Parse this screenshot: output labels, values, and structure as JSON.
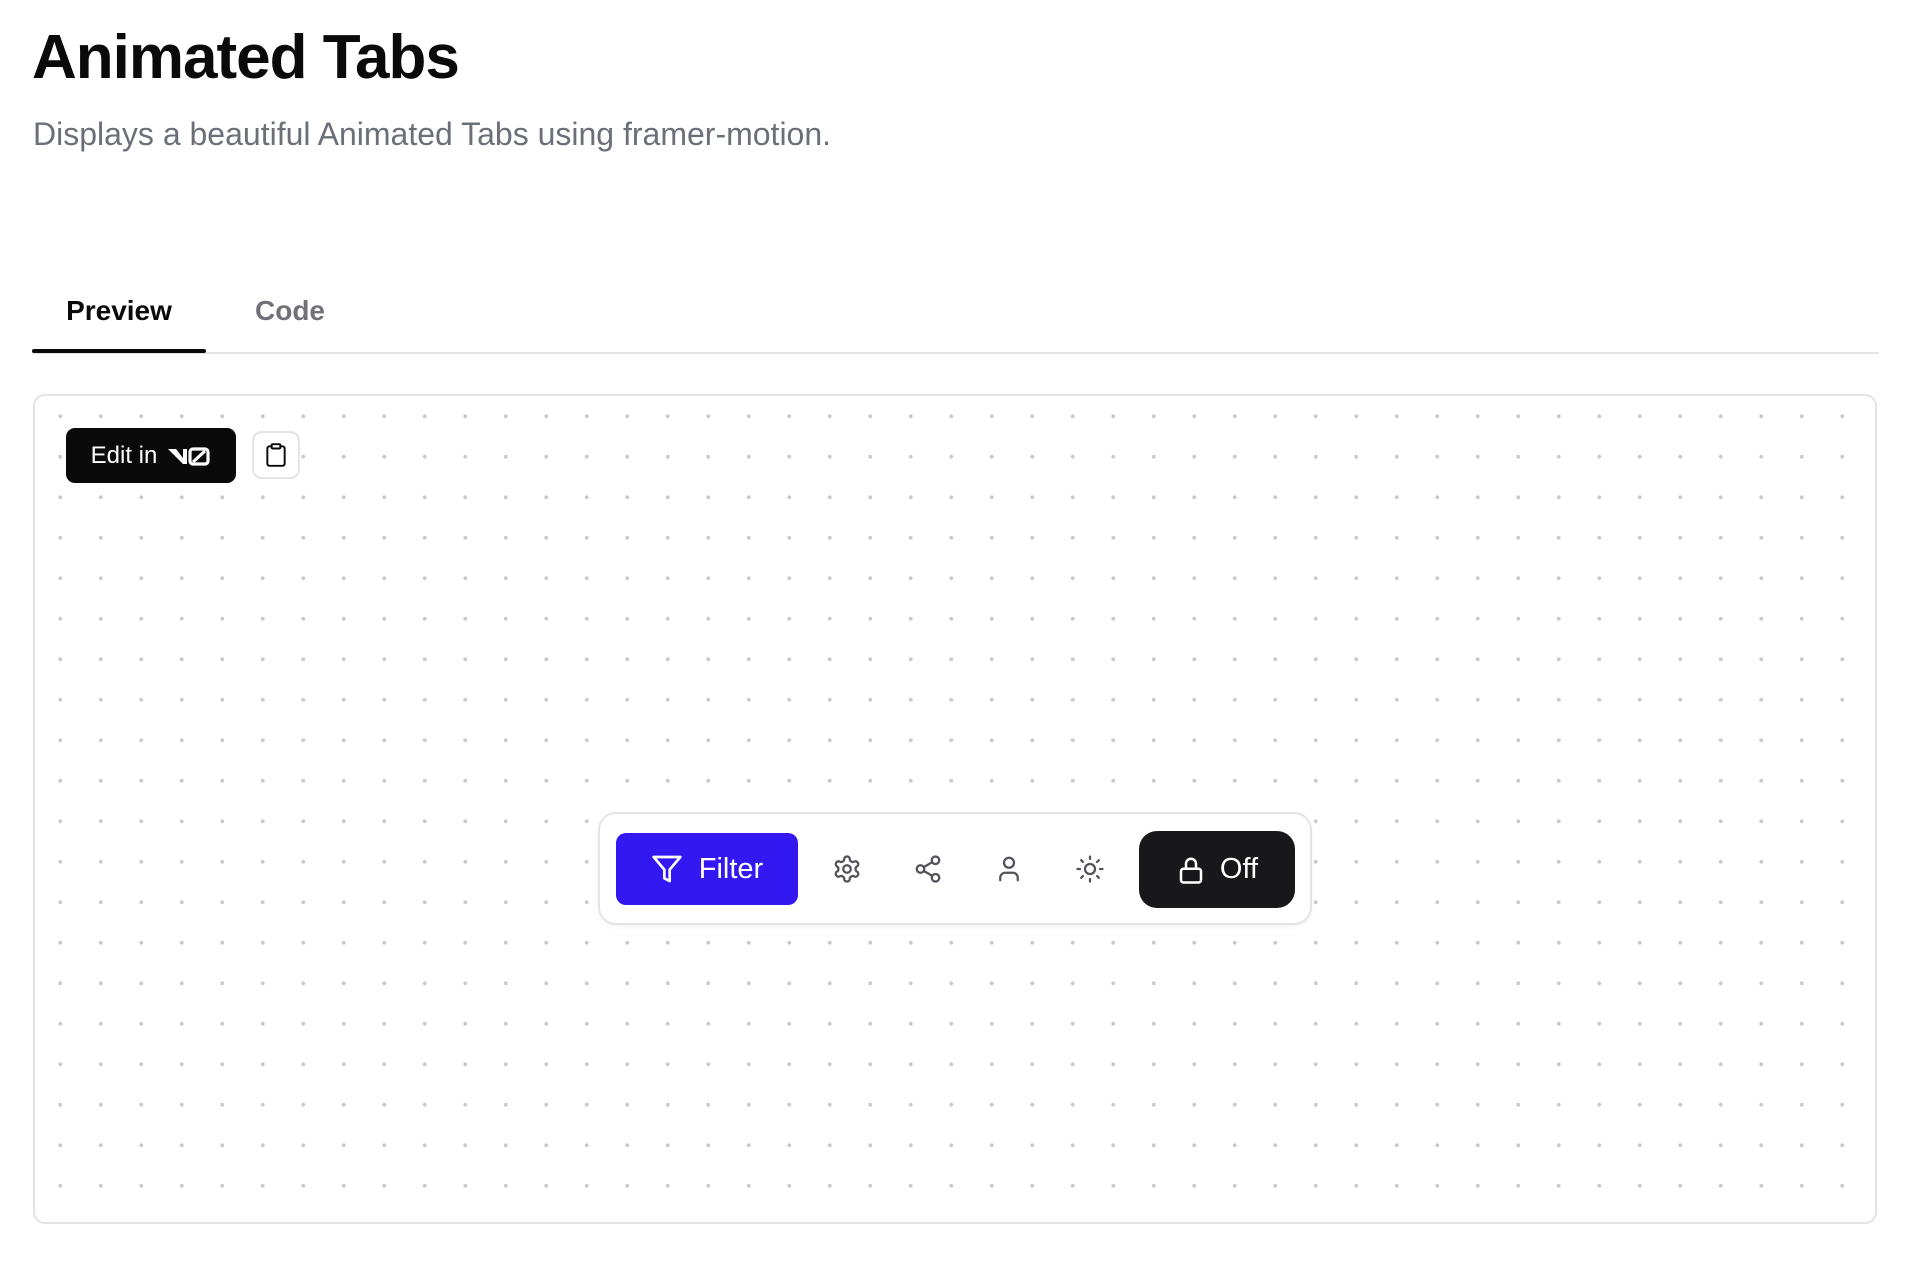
{
  "header": {
    "title": "Animated Tabs",
    "subtitle": "Displays a beautiful Animated Tabs using framer-motion."
  },
  "tabs": [
    {
      "label": "Preview",
      "active": true
    },
    {
      "label": "Code",
      "active": false
    }
  ],
  "preview": {
    "edit_button": {
      "label": "Edit in",
      "logo": "v0-logo"
    },
    "copy_button": {
      "icon": "clipboard-icon"
    },
    "toolbar": {
      "filter_button": {
        "label": "Filter",
        "icon": "filter-icon"
      },
      "icon_buttons": [
        {
          "icon": "gear-icon"
        },
        {
          "icon": "share-icon"
        },
        {
          "icon": "user-icon"
        },
        {
          "icon": "sun-icon"
        }
      ],
      "lock_button": {
        "label": "Off",
        "icon": "lock-icon"
      }
    }
  },
  "colors": {
    "accent": "#3418f2",
    "dark": "#18181b",
    "muted_text": "#6b6f78",
    "border": "#e4e4e7"
  }
}
